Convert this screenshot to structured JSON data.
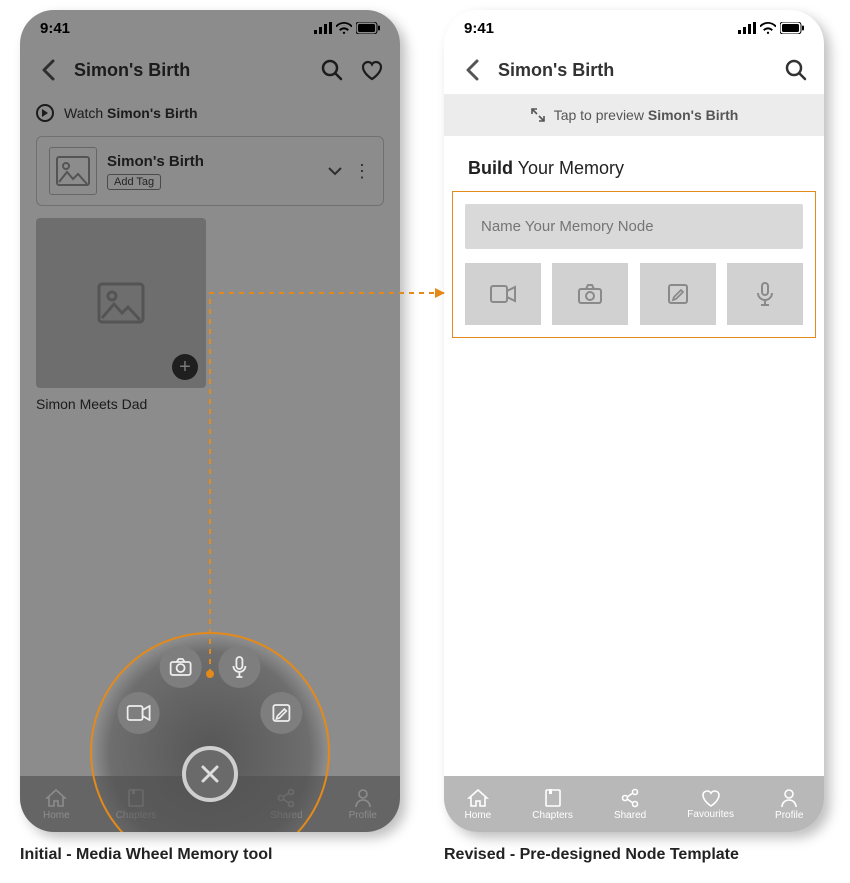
{
  "colors": {
    "accent": "#e48a1a"
  },
  "status": {
    "time": "9:41"
  },
  "left": {
    "title": "Simon's Birth",
    "watch_prefix": "Watch ",
    "watch_bold": "Simon's Birth",
    "card": {
      "title": "Simon's Birth",
      "add_tag": "Add Tag"
    },
    "tile_caption": "Simon Meets Dad",
    "tabs": {
      "home": "Home",
      "chapters": "Chapters",
      "shared": "Shared",
      "profile": "Profile"
    },
    "caption": "Initial - Media Wheel Memory tool"
  },
  "right": {
    "title": "Simon's Birth",
    "preview_prefix": "Tap to preview ",
    "preview_bold": "Simon's Birth",
    "build_bold": "Build",
    "build_rest": " Your Memory",
    "name_placeholder": "Name Your Memory Node",
    "tabs": {
      "home": "Home",
      "chapters": "Chapters",
      "shared": "Shared",
      "favourites": "Favourites",
      "profile": "Profile"
    },
    "caption": "Revised - Pre-designed Node Template"
  }
}
